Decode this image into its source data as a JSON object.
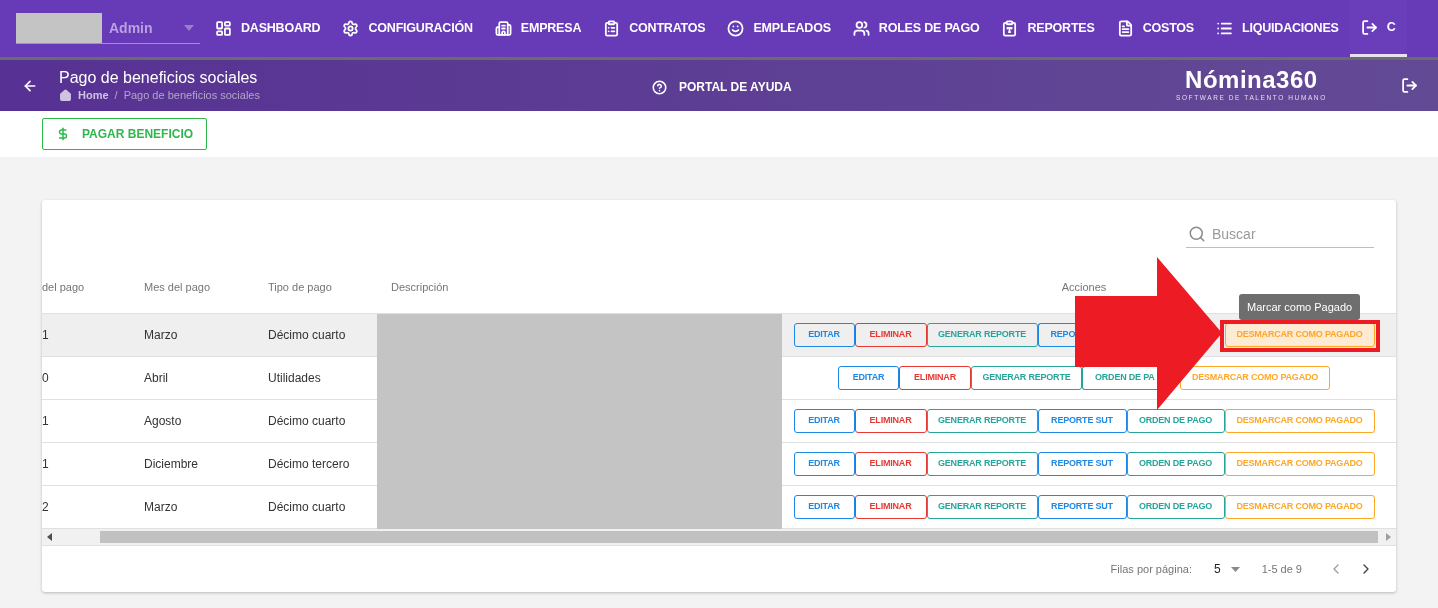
{
  "nav": {
    "user": "Admin",
    "items": [
      {
        "label": "DASHBOARD",
        "selected": false
      },
      {
        "label": "CONFIGURACIÓN",
        "selected": false
      },
      {
        "label": "EMPRESA",
        "selected": false
      },
      {
        "label": "CONTRATOS",
        "selected": false
      },
      {
        "label": "EMPLEADOS",
        "selected": false
      },
      {
        "label": "ROLES DE PAGO",
        "selected": false
      },
      {
        "label": "REPORTES",
        "selected": false
      },
      {
        "label": "COSTOS",
        "selected": false
      },
      {
        "label": "LIQUIDACIONES",
        "selected": false
      },
      {
        "label": "C",
        "selected": true
      }
    ]
  },
  "header": {
    "title": "Pago de beneficios sociales",
    "breadcrumb": {
      "home": "Home",
      "separator": "/",
      "current": "Pago de beneficios sociales"
    },
    "help": "PORTAL DE AYUDA",
    "logo": {
      "name": "Nómina360",
      "tagline": "SOFTWARE DE TALENTO HUMANO"
    }
  },
  "toolbar": {
    "button": "PAGAR BENEFICIO"
  },
  "table": {
    "search": {
      "placeholder": "Buscar"
    },
    "columns": [
      "del pago",
      "Mes del pago",
      "Tipo de pago",
      "Descripción",
      "Acciones"
    ],
    "rows": [
      {
        "cells": [
          "1",
          "Marzo",
          "Décimo cuarto"
        ],
        "hovered": true,
        "actions": [
          {
            "label": "EDITAR",
            "kind": "edit",
            "hovered": false
          },
          {
            "label": "ELIMINAR",
            "kind": "delete",
            "hovered": false
          },
          {
            "label": "GENERAR REPORTE",
            "kind": "report",
            "hovered": false
          },
          {
            "label": "REPO",
            "kind": "sut",
            "hovered": false,
            "cut": true
          },
          {
            "kind": "order"
          },
          {
            "label": "DESMARCAR COMO PAGADO",
            "kind": "unmark",
            "hovered": true
          }
        ]
      },
      {
        "cells": [
          "0",
          "Abril",
          "Utilidades"
        ],
        "hovered": false,
        "actions": [
          {
            "label": "EDITAR",
            "kind": "edit",
            "hovered": false
          },
          {
            "label": "ELIMINAR",
            "kind": "delete",
            "hovered": false
          },
          {
            "label": "GENERAR REPORTE",
            "kind": "report",
            "hovered": false
          },
          {
            "label": "ORDEN DE PA",
            "kind": "order",
            "hovered": false,
            "cut": true
          },
          {
            "label": "DESMARCAR COMO PAGADO",
            "kind": "unmark",
            "hovered": false
          }
        ]
      },
      {
        "cells": [
          "1",
          "Agosto",
          "Décimo cuarto"
        ],
        "hovered": false,
        "actions": [
          {
            "label": "EDITAR",
            "kind": "edit",
            "hovered": false
          },
          {
            "label": "ELIMINAR",
            "kind": "delete",
            "hovered": false
          },
          {
            "label": "GENERAR REPORTE",
            "kind": "report",
            "hovered": false
          },
          {
            "label": "REPORTE SUT",
            "kind": "sut",
            "hovered": false
          },
          {
            "label": "ORDEN DE PAGO",
            "kind": "order",
            "hovered": false
          },
          {
            "label": "DESMARCAR COMO PAGADO",
            "kind": "unmark",
            "hovered": false
          }
        ]
      },
      {
        "cells": [
          "1",
          "Diciembre",
          "Décimo tercero"
        ],
        "hovered": false,
        "actions": [
          {
            "label": "EDITAR",
            "kind": "edit",
            "hovered": false
          },
          {
            "label": "ELIMINAR",
            "kind": "delete",
            "hovered": false
          },
          {
            "label": "GENERAR REPORTE",
            "kind": "report",
            "hovered": false
          },
          {
            "label": "REPORTE SUT",
            "kind": "sut",
            "hovered": false
          },
          {
            "label": "ORDEN DE PAGO",
            "kind": "order",
            "hovered": false
          },
          {
            "label": "DESMARCAR COMO PAGADO",
            "kind": "unmark",
            "hovered": false
          }
        ]
      },
      {
        "cells": [
          "2",
          "Marzo",
          "Décimo cuarto"
        ],
        "hovered": false,
        "actions": [
          {
            "label": "EDITAR",
            "kind": "edit",
            "hovered": false
          },
          {
            "label": "ELIMINAR",
            "kind": "delete",
            "hovered": false
          },
          {
            "label": "GENERAR REPORTE",
            "kind": "report",
            "hovered": false
          },
          {
            "label": "REPORTE SUT",
            "kind": "sut",
            "hovered": false
          },
          {
            "label": "ORDEN DE PAGO",
            "kind": "order",
            "hovered": false
          },
          {
            "label": "DESMARCAR COMO PAGADO",
            "kind": "unmark",
            "hovered": false
          }
        ]
      }
    ],
    "tooltip": "Marcar como Pagado",
    "pagination": {
      "label": "Filas por página:",
      "rows_per_page": "5",
      "range": "1-5 de 9"
    }
  }
}
